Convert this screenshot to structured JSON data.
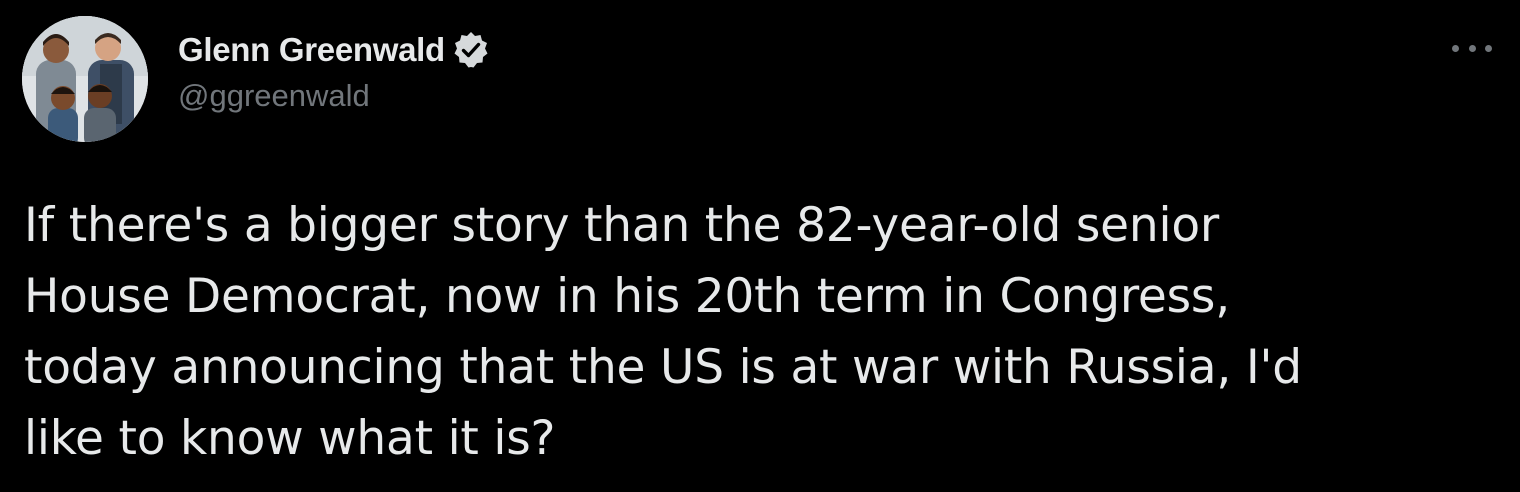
{
  "author": {
    "display_name": "Glenn Greenwald",
    "handle": "@ggreenwald",
    "verified": true
  },
  "icons": {
    "verified": "verified-badge-icon",
    "more": "more-options-icon"
  },
  "tweet": {
    "lines": [
      "If there's a bigger story than the 82-year-old senior",
      "House Democrat, now in his 20th term in Congress,",
      "today announcing that the US is at war with Russia, I'd",
      "like to know what it is?"
    ]
  },
  "colors": {
    "background": "#000000",
    "primary_text": "#e7e9ea",
    "secondary_text": "#71767b"
  }
}
